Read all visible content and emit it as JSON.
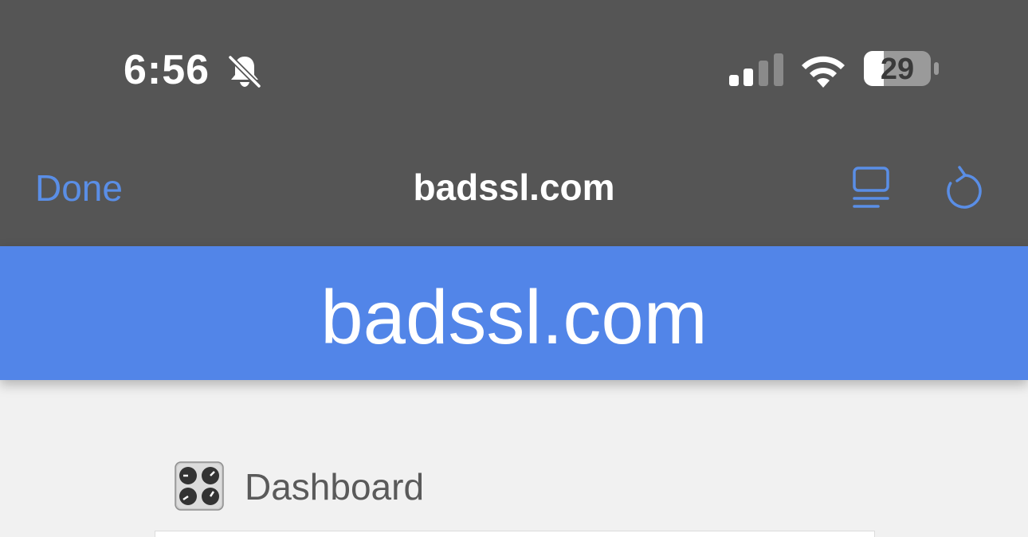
{
  "status_bar": {
    "time": "6:56",
    "battery_level": "29",
    "icons": [
      "bell-slash-icon",
      "cellular-signal-icon",
      "wifi-icon",
      "battery-icon"
    ]
  },
  "nav_bar": {
    "done_label": "Done",
    "title": "badssl.com",
    "icons": [
      "reader-icon",
      "reload-icon"
    ]
  },
  "page": {
    "banner_title": "badssl.com",
    "dashboard_label": "Dashboard",
    "dashboard_icon": "control-knobs-icon"
  },
  "colors": {
    "chrome_background": "#555555",
    "accent_link": "#5a8ee6",
    "banner_background": "#5285e8",
    "page_background": "#f1f1f1"
  }
}
